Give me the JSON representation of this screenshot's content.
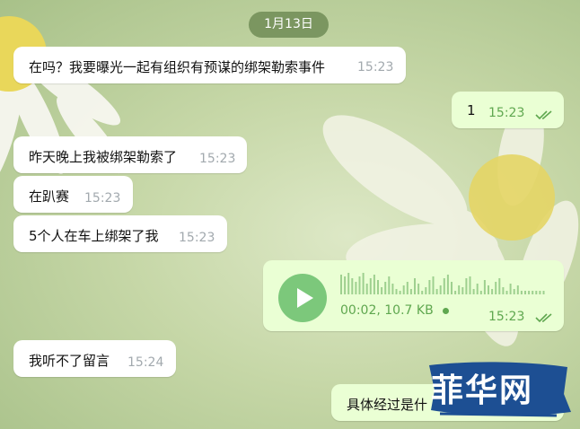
{
  "date_label": "1月13日",
  "colors": {
    "incoming_bubble": "#ffffff",
    "outgoing_bubble": "#eaffd4",
    "outgoing_time": "#5fa74f",
    "incoming_time": "#a2a9ae",
    "date_pill": "#708c56",
    "watermark_blue": "#1d4f93"
  },
  "messages": [
    {
      "direction": "incoming",
      "text": "在吗？我要曝光一起有组织有预谋的绑架勒索事件",
      "time": "15:23"
    },
    {
      "direction": "outgoing",
      "text": "1",
      "time": "15:23",
      "status_icon": "double-check-icon"
    },
    {
      "direction": "incoming",
      "text": "昨天晚上我被绑架勒索了",
      "time": "15:23"
    },
    {
      "direction": "incoming",
      "text": "在趴赛",
      "time": "15:23"
    },
    {
      "direction": "incoming",
      "text": "5个人在车上绑架了我",
      "time": "15:23"
    },
    {
      "direction": "outgoing",
      "type": "voice",
      "duration": "00:02",
      "size": "10.7 KB",
      "time": "15:23",
      "status_icon": "double-check-icon",
      "play_icon": "play-icon"
    },
    {
      "direction": "incoming",
      "text": "我听不了留言",
      "time": "15:24"
    },
    {
      "direction": "outgoing",
      "text": "具体经过是什",
      "time": ""
    }
  ],
  "watermark": {
    "text": "菲华网"
  }
}
